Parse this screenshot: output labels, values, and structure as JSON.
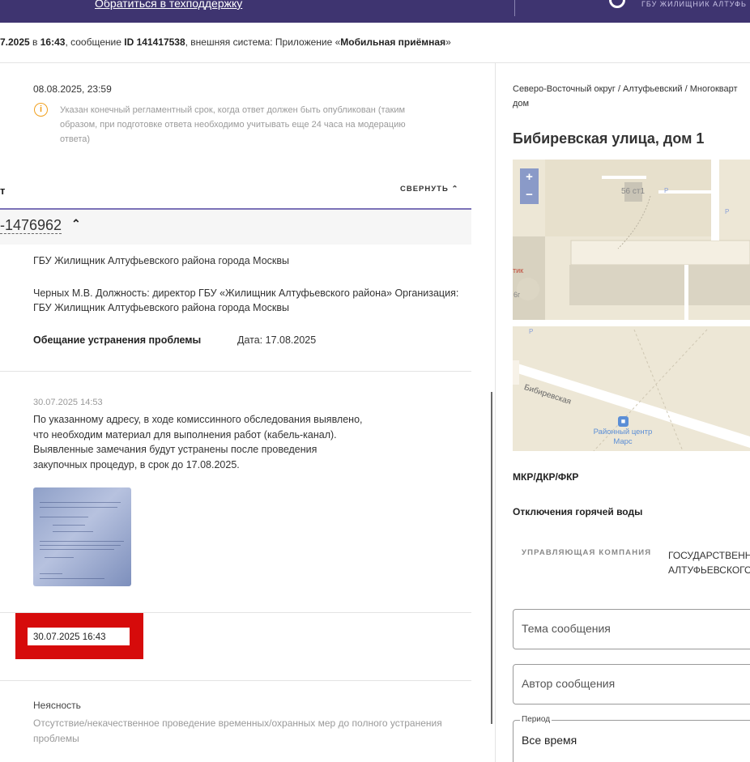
{
  "header": {
    "support_link": "Обратиться в техподдержку",
    "org_name": "ГБУ ЖИЛИЩНИК АЛТУФЬ"
  },
  "info_line": {
    "date_part": "7.2025",
    "in": " в ",
    "time": "16:43",
    "msg_prefix": ", сообщение ",
    "msg_id": "ID 141417538",
    "system_prefix": ", внешняя система: Приложение «",
    "system_name": "Мобильная приёмная",
    "system_suffix": "»"
  },
  "deadline": {
    "datetime": "08.08.2025, 23:59",
    "notice": "Указан конечный регламентный срок, когда ответ должен быть опубликован (таким образом, при подготовке ответа необходимо учитывать еще 24 часа на модерацию ответа)"
  },
  "answer_section": {
    "heading": "т",
    "collapse_label": "СВЕРНУТЬ",
    "accordion_id": "-1476962",
    "organization": "ГБУ Жилищник Алтуфьевского района города Москвы",
    "signer_line1": "Черных М.В. Должность: директор ГБУ «Жилищник Алтуфьевского района» Организация:",
    "signer_line2": "ГБУ Жилищник Алтуфьевского района города Москвы",
    "promise_label": "Обещание устранения проблемы",
    "promise_date": "Дата: 17.08.2025"
  },
  "message": {
    "timestamp": "30.07.2025 14:53",
    "lines": [
      "По указанному адресу, в ходе комиссинного обследования выявлено,",
      "что необходим материал для выполнения работ (кабель-канал).",
      "Выявленные замечания будут устранены после проведения",
      "закупочных процедур, в срок до 17.08.2025."
    ]
  },
  "highlight": {
    "datetime": "30.07.2025 16:43"
  },
  "issue": {
    "category": "Неясность",
    "description_line1": "Отсутствие/некачественное проведение временных/охранных мер до полного устранения",
    "description_line2": "проблемы"
  },
  "right_panel": {
    "breadcrumb_line1": "Северо-Восточный округ / Алтуфьевский / Многокварт",
    "breadcrumb_line2": "дом",
    "address": "Бибиревская улица, дом 1",
    "map": {
      "zoom_in": "+",
      "zoom_out": "−",
      "building_label": "56 ст1",
      "street_label": "Бибиревская",
      "poi_label_line1": "Районный центр",
      "poi_label_line2": "Марс",
      "partial_label": "тик",
      "partial_label2": "6г",
      "parking": "P"
    },
    "mkr_label": "МКР/ДКР/ФКР",
    "hot_water_label": "Отключения горячей воды",
    "mc_label": "УПРАВЛЯЮЩАЯ КОМПАНИЯ",
    "mc_value_line1": "ГОСУДАРСТВЕНН",
    "mc_value_line2": "АЛТУФЬЕВСКОГО",
    "topic_placeholder": "Тема сообщения",
    "author_placeholder": "Автор сообщения",
    "period_legend": "Период",
    "period_value": "Все время"
  },
  "colors": {
    "topbar": "#3e3470",
    "accent": "#7b72b8",
    "warning": "#f0a01e",
    "highlight_red": "#d60b0b"
  }
}
